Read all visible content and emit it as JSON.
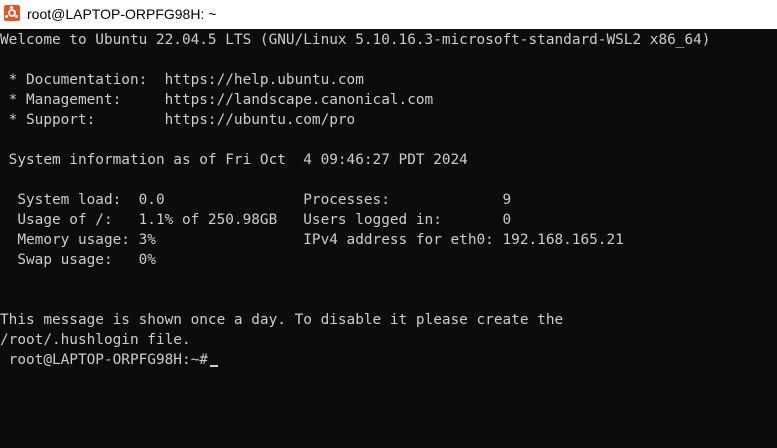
{
  "window": {
    "title": "root@LAPTOP-ORPFG98H: ~",
    "icon": "ubuntu-icon",
    "accent": "#e95420"
  },
  "terminal": {
    "background": "#0c0c0c",
    "foreground": "#cccccc",
    "lines": [
      "Welcome to Ubuntu 22.04.5 LTS (GNU/Linux 5.10.16.3-microsoft-standard-WSL2 x86_64)",
      "",
      " * Documentation:  https://help.ubuntu.com",
      " * Management:     https://landscape.canonical.com",
      " * Support:        https://ubuntu.com/pro",
      "",
      " System information as of Fri Oct  4 09:46:27 PDT 2024",
      "",
      "  System load:  0.0                Processes:             9",
      "  Usage of /:   1.1% of 250.98GB   Users logged in:       0",
      "  Memory usage: 3%                 IPv4 address for eth0: 192.168.165.21",
      "  Swap usage:   0%",
      "",
      "",
      "This message is shown once a day. To disable it please create the",
      "/root/.hushlogin file.",
      " root@LAPTOP-ORPFG98H:~#"
    ]
  }
}
